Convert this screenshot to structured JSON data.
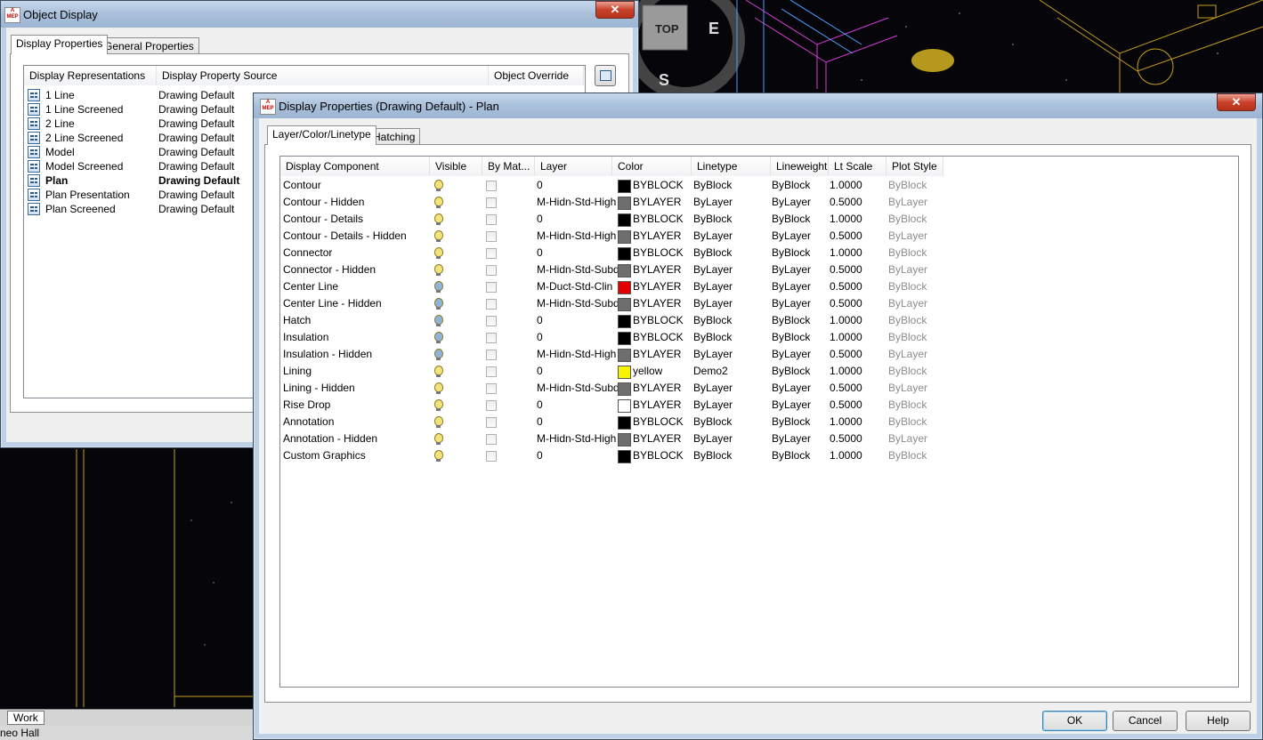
{
  "cad": {
    "viewcube_top": "TOP",
    "compass_e": "E",
    "compass_s": "S",
    "layout_tab": "Work",
    "status_text": "neo Hall"
  },
  "object_display": {
    "title": "Object Display",
    "tabs": [
      "Display Properties",
      "General Properties"
    ],
    "columns": [
      "Display Representations",
      "Display Property Source",
      "Object Override"
    ],
    "rows": [
      {
        "name": "1 Line",
        "source": "Drawing Default"
      },
      {
        "name": "1 Line Screened",
        "source": "Drawing Default"
      },
      {
        "name": "2 Line",
        "source": "Drawing Default"
      },
      {
        "name": "2 Line Screened",
        "source": "Drawing Default"
      },
      {
        "name": "Model",
        "source": "Drawing Default"
      },
      {
        "name": "Model Screened",
        "source": "Drawing Default"
      },
      {
        "name": "Plan",
        "source": "Drawing Default",
        "bold": true
      },
      {
        "name": "Plan Presentation",
        "source": "Drawing Default"
      },
      {
        "name": "Plan Screened",
        "source": "Drawing Default"
      }
    ]
  },
  "display_props": {
    "title": "Display Properties (Drawing Default) - Plan",
    "tabs": [
      "Layer/Color/Linetype",
      "Hatching"
    ],
    "columns": [
      "Display Component",
      "Visible",
      "By Mat...",
      "Layer",
      "Color",
      "Linetype",
      "Lineweight",
      "Lt Scale",
      "Plot Style"
    ],
    "rows": [
      {
        "component": "Contour",
        "bulb": "yellow",
        "layer": "0",
        "swatch": "#000000",
        "color": "BYBLOCK",
        "linetype": "ByBlock",
        "lineweight": "ByBlock",
        "ltscale": "1.0000",
        "plotstyle": "ByBlock"
      },
      {
        "component": "Contour - Hidden",
        "bulb": "yellow",
        "layer": "M-Hidn-Std-High",
        "swatch": "#6e6e6e",
        "color": "BYLAYER",
        "linetype": "ByLayer",
        "lineweight": "ByLayer",
        "ltscale": "0.5000",
        "plotstyle": "ByLayer"
      },
      {
        "component": "Contour - Details",
        "bulb": "yellow",
        "layer": "0",
        "swatch": "#000000",
        "color": "BYBLOCK",
        "linetype": "ByBlock",
        "lineweight": "ByBlock",
        "ltscale": "1.0000",
        "plotstyle": "ByBlock"
      },
      {
        "component": "Contour - Details - Hidden",
        "bulb": "yellow",
        "layer": "M-Hidn-Std-High",
        "swatch": "#6e6e6e",
        "color": "BYLAYER",
        "linetype": "ByLayer",
        "lineweight": "ByLayer",
        "ltscale": "0.5000",
        "plotstyle": "ByLayer"
      },
      {
        "component": "Connector",
        "bulb": "yellow",
        "layer": "0",
        "swatch": "#000000",
        "color": "BYBLOCK",
        "linetype": "ByBlock",
        "lineweight": "ByBlock",
        "ltscale": "1.0000",
        "plotstyle": "ByBlock"
      },
      {
        "component": "Connector - Hidden",
        "bulb": "yellow",
        "layer": "M-Hidn-Std-Subd",
        "swatch": "#6e6e6e",
        "color": "BYLAYER",
        "linetype": "ByLayer",
        "lineweight": "ByLayer",
        "ltscale": "0.5000",
        "plotstyle": "ByLayer"
      },
      {
        "component": "Center Line",
        "bulb": "blue",
        "layer": "M-Duct-Std-Clin",
        "swatch": "#e00000",
        "color": "BYLAYER",
        "linetype": "ByLayer",
        "lineweight": "ByLayer",
        "ltscale": "0.5000",
        "plotstyle": "ByBlock"
      },
      {
        "component": "Center Line - Hidden",
        "bulb": "blue",
        "layer": "M-Hidn-Std-Subd",
        "swatch": "#6e6e6e",
        "color": "BYLAYER",
        "linetype": "ByLayer",
        "lineweight": "ByLayer",
        "ltscale": "0.5000",
        "plotstyle": "ByLayer"
      },
      {
        "component": "Hatch",
        "bulb": "blue",
        "layer": "0",
        "swatch": "#000000",
        "color": "BYBLOCK",
        "linetype": "ByBlock",
        "lineweight": "ByBlock",
        "ltscale": "1.0000",
        "plotstyle": "ByBlock"
      },
      {
        "component": "Insulation",
        "bulb": "blue",
        "layer": "0",
        "swatch": "#000000",
        "color": "BYBLOCK",
        "linetype": "ByBlock",
        "lineweight": "ByBlock",
        "ltscale": "1.0000",
        "plotstyle": "ByBlock"
      },
      {
        "component": "Insulation - Hidden",
        "bulb": "blue",
        "layer": "M-Hidn-Std-High",
        "swatch": "#6e6e6e",
        "color": "BYLAYER",
        "linetype": "ByLayer",
        "lineweight": "ByLayer",
        "ltscale": "0.5000",
        "plotstyle": "ByLayer"
      },
      {
        "component": "Lining",
        "bulb": "yellow",
        "layer": "0",
        "swatch": "#f5f500",
        "color": "yellow",
        "linetype": "Demo2",
        "lineweight": "ByBlock",
        "ltscale": "1.0000",
        "plotstyle": "ByBlock"
      },
      {
        "component": "Lining - Hidden",
        "bulb": "yellow",
        "layer": "M-Hidn-Std-Subd",
        "swatch": "#6e6e6e",
        "color": "BYLAYER",
        "linetype": "ByLayer",
        "lineweight": "ByLayer",
        "ltscale": "0.5000",
        "plotstyle": "ByLayer"
      },
      {
        "component": "Rise Drop",
        "bulb": "yellow",
        "layer": "0",
        "swatch": "#ffffff",
        "color": "BYLAYER",
        "linetype": "ByLayer",
        "lineweight": "ByLayer",
        "ltscale": "0.5000",
        "plotstyle": "ByBlock"
      },
      {
        "component": "Annotation",
        "bulb": "yellow",
        "layer": "0",
        "swatch": "#000000",
        "color": "BYBLOCK",
        "linetype": "ByBlock",
        "lineweight": "ByBlock",
        "ltscale": "1.0000",
        "plotstyle": "ByBlock"
      },
      {
        "component": "Annotation - Hidden",
        "bulb": "yellow",
        "layer": "M-Hidn-Std-High",
        "swatch": "#6e6e6e",
        "color": "BYLAYER",
        "linetype": "ByLayer",
        "lineweight": "ByLayer",
        "ltscale": "0.5000",
        "plotstyle": "ByLayer"
      },
      {
        "component": "Custom Graphics",
        "bulb": "yellow",
        "layer": "0",
        "swatch": "#000000",
        "color": "BYBLOCK",
        "linetype": "ByBlock",
        "lineweight": "ByBlock",
        "ltscale": "1.0000",
        "plotstyle": "ByBlock"
      }
    ],
    "buttons": {
      "ok": "OK",
      "cancel": "Cancel",
      "help": "Help"
    },
    "colors": {
      "bulb_yellow": "#f4e27a",
      "bulb_blue": "#8fb4d9",
      "plotstyle_text": "#8c8c8c"
    }
  }
}
